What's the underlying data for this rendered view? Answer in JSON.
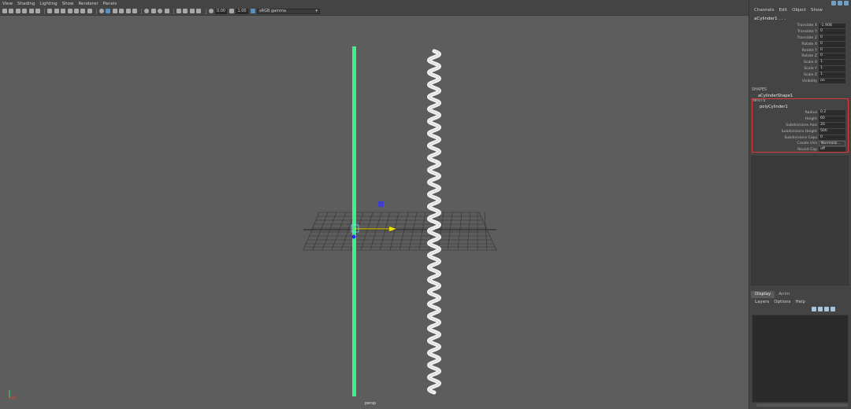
{
  "menu": [
    "View",
    "Shading",
    "Lighting",
    "Show",
    "Renderer",
    "Panels"
  ],
  "toolbar": {
    "exposure_value": "0.00",
    "gamma_value": "1.00",
    "color_space": "sRGB gamma"
  },
  "viewport": {
    "camera_label": "persp",
    "axis_y": "y",
    "axis_x": "x"
  },
  "channel_box": {
    "tabs": [
      "Channels",
      "Edit",
      "Object",
      "Show"
    ],
    "object_name": "aCylinder1 . . .",
    "attributes": [
      {
        "label": "Translate X",
        "value": "-1.908"
      },
      {
        "label": "Translate Y",
        "value": "0"
      },
      {
        "label": "Translate Z",
        "value": "0"
      },
      {
        "label": "Rotate X",
        "value": "0"
      },
      {
        "label": "Rotate Y",
        "value": "0"
      },
      {
        "label": "Rotate Z",
        "value": "0"
      },
      {
        "label": "Scale X",
        "value": "1"
      },
      {
        "label": "Scale Y",
        "value": "1"
      },
      {
        "label": "Scale Z",
        "value": "1"
      },
      {
        "label": "Visibility",
        "value": "on"
      }
    ],
    "shapes_header": "SHAPES",
    "shape_name": "aCylinderShape1",
    "inputs_header": "INPUTS",
    "input_name": "polyCylinder1",
    "input_attributes": [
      {
        "label": "Radius",
        "value": "0.2"
      },
      {
        "label": "Height",
        "value": "60"
      },
      {
        "label": "Subdivisions Axis",
        "value": "20"
      },
      {
        "label": "Subdivisions Height",
        "value": "500"
      },
      {
        "label": "Subdivisions Caps",
        "value": "0"
      },
      {
        "label": "Create UVs",
        "value": "Normaliz..."
      },
      {
        "label": "Round Cap",
        "value": "off"
      }
    ]
  },
  "layer_editor": {
    "tabs": [
      "Display",
      "Anim"
    ],
    "menu": [
      "Layers",
      "Options",
      "Help"
    ]
  },
  "colors": {
    "viewport_bg": "#5d5d5d",
    "panel_bg": "#444444",
    "green_cylinder": "#3df08a",
    "highlight_box": "#d93a3a",
    "manip_yellow": "#f0e000",
    "manip_blue": "#3a3ae0"
  }
}
